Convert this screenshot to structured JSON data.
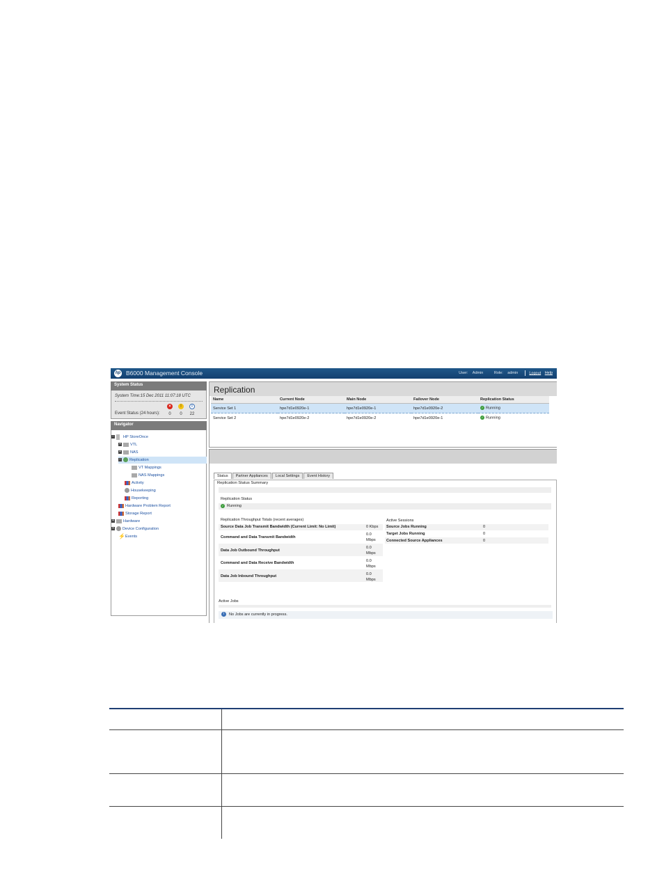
{
  "topbar": {
    "title": "B6000 Management Console",
    "user_label": "User:",
    "user": "Admin",
    "role_label": "Role:",
    "role": "admin",
    "logout": "Logout",
    "help": "Help"
  },
  "system_status": {
    "header": "System Status",
    "system_time": "System Time:15 Dec 2011 11:07:18 UTC",
    "event_label": "Event Status (24 hours):",
    "errors": "0",
    "warnings": "0",
    "info": "22"
  },
  "navigator": {
    "header": "Navigator",
    "items": [
      {
        "label": "HP StoreOnce"
      },
      {
        "label": "VTL"
      },
      {
        "label": "NAS"
      },
      {
        "label": "Replication"
      },
      {
        "label": "VT Mappings"
      },
      {
        "label": "NAS Mappings"
      },
      {
        "label": "Activity"
      },
      {
        "label": "Housekeeping"
      },
      {
        "label": "Reporting"
      },
      {
        "label": "Hardware Problem Report"
      },
      {
        "label": "Storage Report"
      },
      {
        "label": "Hardware"
      },
      {
        "label": "Device Configuration"
      },
      {
        "label": "Events"
      }
    ]
  },
  "replication": {
    "title": "Replication",
    "columns": [
      "Name",
      "Current Node",
      "Main Node",
      "Failover Node",
      "Replication Status"
    ],
    "rows": [
      [
        "Service Set 1",
        "hpe7d1e0920e-1",
        "hpe7d1e0920e-1",
        "hpe7d1e0920e-2",
        "Running"
      ],
      [
        "Service Set 2",
        "hpe7d1e0920e-2",
        "hpe7d1e0920e-2",
        "hpe7d1e0920e-1",
        "Running"
      ]
    ]
  },
  "tabs": [
    "Status",
    "Partner Appliances",
    "Local Settings",
    "Event History"
  ],
  "status": {
    "summary": "Replication Status Summary",
    "rep_status_label": "Replication Status",
    "rep_status_value": "Running",
    "throughput_label": "Replication Throughput Totals (recent averages)",
    "throughput": [
      {
        "label": "Source Data Job Transmit Bandwidth (Current Limit: No Limit)",
        "value": "0 Kbps"
      },
      {
        "label": "Command and Data Transmit Bandwidth",
        "value": "0.0 Mbps"
      },
      {
        "label": "Data Job Outbound Throughput",
        "value": "0.0 Mbps"
      },
      {
        "label": "Command and Data Receive Bandwidth",
        "value": "0.0 Mbps"
      },
      {
        "label": "Data Job Inbound Throughput",
        "value": "0.0 Mbps"
      }
    ],
    "sessions_label": "Active Sessions",
    "sessions": [
      {
        "label": "Source Jobs Running",
        "value": "0"
      },
      {
        "label": "Target Jobs Running",
        "value": "0"
      },
      {
        "label": "Connected Source Appliances",
        "value": "0"
      }
    ],
    "active_jobs_label": "Active Jobs",
    "no_jobs": "No Jobs are currently in progress."
  }
}
